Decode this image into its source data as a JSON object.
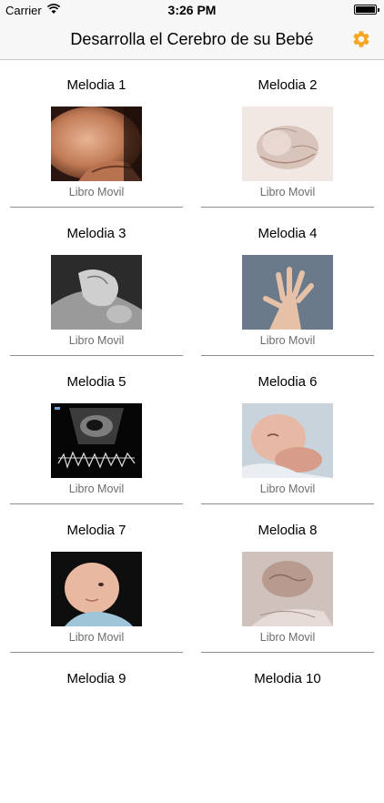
{
  "status_bar": {
    "carrier": "Carrier",
    "time": "3:26 PM"
  },
  "nav": {
    "title": "Desarrolla el Cerebro de su Bebé",
    "settings_icon": "gear-icon",
    "accent_color": "#f5a623"
  },
  "items": [
    {
      "title": "Melodia 1",
      "subtitle": "Libro Movil",
      "image": "pregnant-belly-photo"
    },
    {
      "title": "Melodia 2",
      "subtitle": "Libro Movil",
      "image": "sleeping-baby-sepia-photo"
    },
    {
      "title": "Melodia 3",
      "subtitle": "Libro Movil",
      "image": "holding-baby-hand-bw-photo"
    },
    {
      "title": "Melodia 4",
      "subtitle": "Libro Movil",
      "image": "baby-hand-photo"
    },
    {
      "title": "Melodia 5",
      "subtitle": "Libro Movil",
      "image": "ultrasound-photo"
    },
    {
      "title": "Melodia 6",
      "subtitle": "Libro Movil",
      "image": "newborn-sleeping-photo"
    },
    {
      "title": "Melodia 7",
      "subtitle": "Libro Movil",
      "image": "baby-looking-up-photo"
    },
    {
      "title": "Melodia 8",
      "subtitle": "Libro Movil",
      "image": "baby-fist-sepia-photo"
    },
    {
      "title": "Melodia 9",
      "subtitle": "",
      "image": ""
    },
    {
      "title": "Melodia 10",
      "subtitle": "",
      "image": ""
    }
  ]
}
